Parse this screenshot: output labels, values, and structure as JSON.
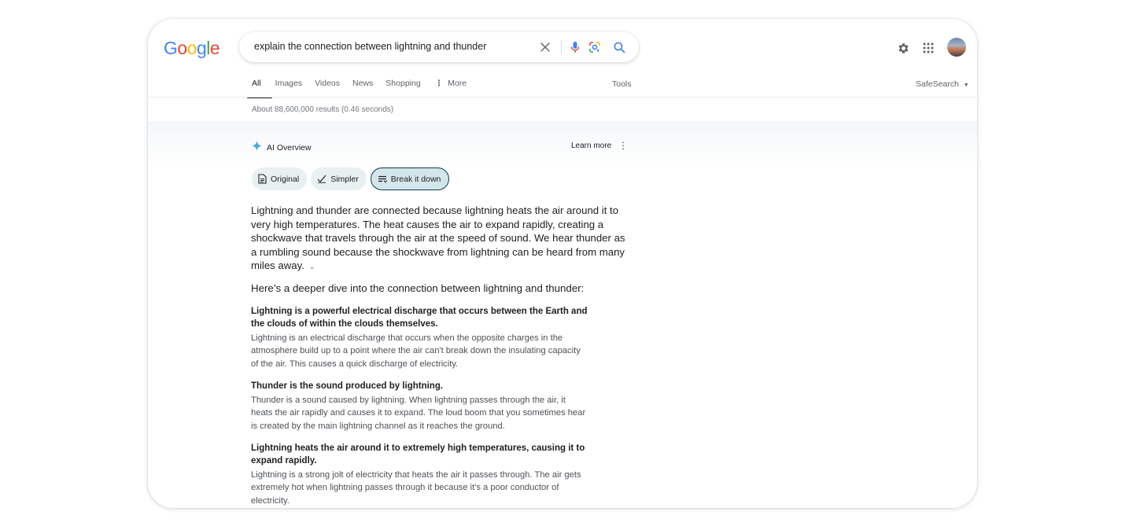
{
  "brand": {
    "logo_letters": [
      "G",
      "o",
      "o",
      "g",
      "l",
      "e"
    ],
    "logo_colors": [
      "#4285F4",
      "#EA4335",
      "#FBBC05",
      "#4285F4",
      "#34A853",
      "#EA4335"
    ]
  },
  "search": {
    "query": "explain the connection between lightning and thunder"
  },
  "tabs": [
    {
      "label": "All"
    },
    {
      "label": "Images"
    },
    {
      "label": "Videos"
    },
    {
      "label": "News"
    },
    {
      "label": "Shopping"
    },
    {
      "label": "More"
    }
  ],
  "tools_label": "Tools",
  "safesearch_label": "SafeSearch",
  "results_count": "About 88,600,000 results (0.46 seconds)",
  "ai_overview": {
    "title": "AI Overview",
    "learn_more": "Learn more",
    "chips": [
      {
        "label": "Original"
      },
      {
        "label": "Simpler"
      },
      {
        "label": "Break it down"
      }
    ],
    "summary": "Lightning and thunder are connected because lightning heats the air around it to very high temperatures. The heat causes the air to expand rapidly, creating a shockwave that travels through the air at the speed of sound. We hear thunder as a rumbling sound because the shockwave from lightning can be heard from many miles away.",
    "deep_dive_heading": "Here’s a deeper dive into the connection between lightning and thunder:",
    "sections": [
      {
        "heading": "Lightning is a powerful electrical discharge that occurs between the Earth and the clouds of within the clouds themselves.",
        "body": "Lightning is an electrical discharge that occurs when the opposite charges in the atmosphere build up to a point where the air can't break down the insulating capacity of the air. This causes a quick discharge of electricity."
      },
      {
        "heading": "Thunder is the sound produced by lightning.",
        "body": "Thunder is a sound caused by lightning. When lightning passes through the air, it heats the air rapidly and causes it to expand. The loud boom that you sometimes hear is created by the main lightning channel as it reaches the ground."
      },
      {
        "heading": "Lightning heats the air around it to extremely high temperatures, causing it to expand rapidly.",
        "body": "Lightning is a strong jolt of electricity that heats the air it passes through. The air gets extremely hot when lightning passes through it because it's a poor conductor of electricity."
      }
    ]
  },
  "icons": {
    "clear": "close-icon",
    "mic": "microphone-icon",
    "lens": "google-lens-icon",
    "search": "search-icon",
    "settings": "gear-icon",
    "apps": "apps-grid-icon",
    "sparkle": "sparkle-icon"
  }
}
